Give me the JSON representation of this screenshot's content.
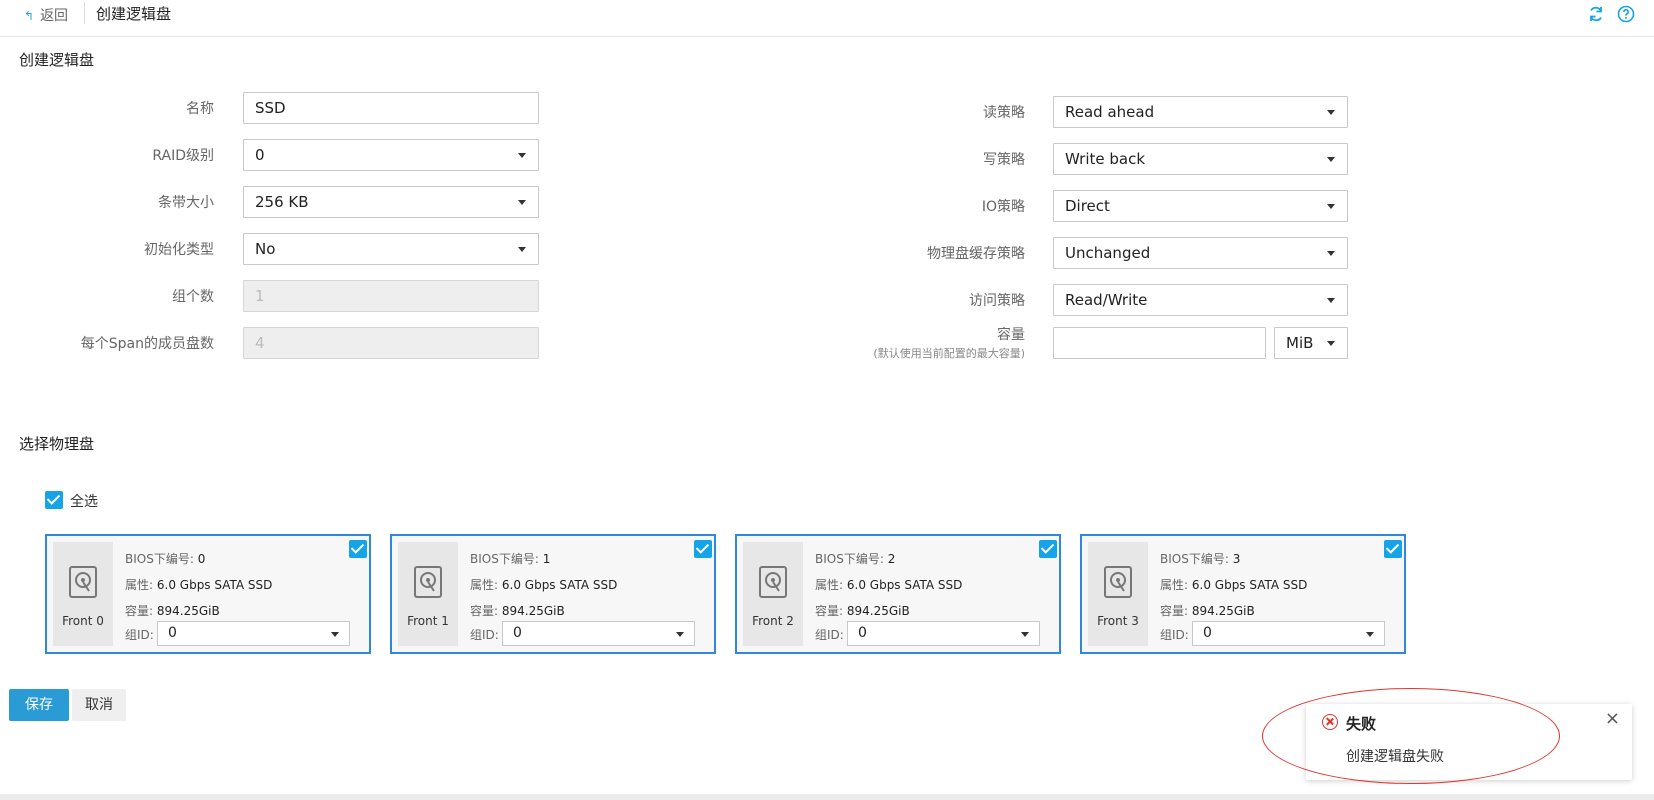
{
  "header": {
    "back_label": "返回",
    "title": "创建逻辑盘",
    "refresh_icon": "refresh-icon",
    "help_icon": "help-icon"
  },
  "form": {
    "section_title": "创建逻辑盘",
    "left": {
      "name": {
        "label": "名称",
        "value": "SSD"
      },
      "raid_level": {
        "label": "RAID级别",
        "value": "0"
      },
      "strip_size": {
        "label": "条带大小",
        "value": "256 KB"
      },
      "init_type": {
        "label": "初始化类型",
        "value": "No"
      },
      "group_count": {
        "label": "组个数",
        "value": "1"
      },
      "span_members": {
        "label": "每个Span的成员盘数",
        "value": "4"
      }
    },
    "right": {
      "read_policy": {
        "label": "读策略",
        "value": "Read ahead"
      },
      "write_policy": {
        "label": "写策略",
        "value": "Write back"
      },
      "io_policy": {
        "label": "IO策略",
        "value": "Direct"
      },
      "disk_cache": {
        "label": "物理盘缓存策略",
        "value": "Unchanged"
      },
      "access_policy": {
        "label": "访问策略",
        "value": "Read/Write"
      },
      "capacity": {
        "label": "容量",
        "hint": "(默认使用当前配置的最大容量)",
        "value": "",
        "unit": "MiB"
      }
    }
  },
  "disks_section": {
    "title": "选择物理盘",
    "select_all_label": "全选",
    "select_all_checked": true,
    "bios_key": "BIOS下编号:",
    "attr_key": "属性:",
    "cap_key": "容量:",
    "group_key": "组ID:",
    "disks": [
      {
        "name": "Front 0",
        "bios": "0",
        "attr": "6.0 Gbps SATA SSD",
        "capacity": "894.25GiB",
        "group_id": "0",
        "checked": true
      },
      {
        "name": "Front 1",
        "bios": "1",
        "attr": "6.0 Gbps SATA SSD",
        "capacity": "894.25GiB",
        "group_id": "0",
        "checked": true
      },
      {
        "name": "Front 2",
        "bios": "2",
        "attr": "6.0 Gbps SATA SSD",
        "capacity": "894.25GiB",
        "group_id": "0",
        "checked": true
      },
      {
        "name": "Front 3",
        "bios": "3",
        "attr": "6.0 Gbps SATA SSD",
        "capacity": "894.25GiB",
        "group_id": "0",
        "checked": true
      }
    ]
  },
  "actions": {
    "save": "保存",
    "cancel": "取消"
  },
  "toast": {
    "title": "失败",
    "message": "创建逻辑盘失败",
    "close": "×",
    "icon": "error-circle-icon"
  },
  "colors": {
    "accent": "#16a4e8",
    "primary_button": "#2a9bd4",
    "card_border": "#2f87e0",
    "error": "#e0342c"
  }
}
